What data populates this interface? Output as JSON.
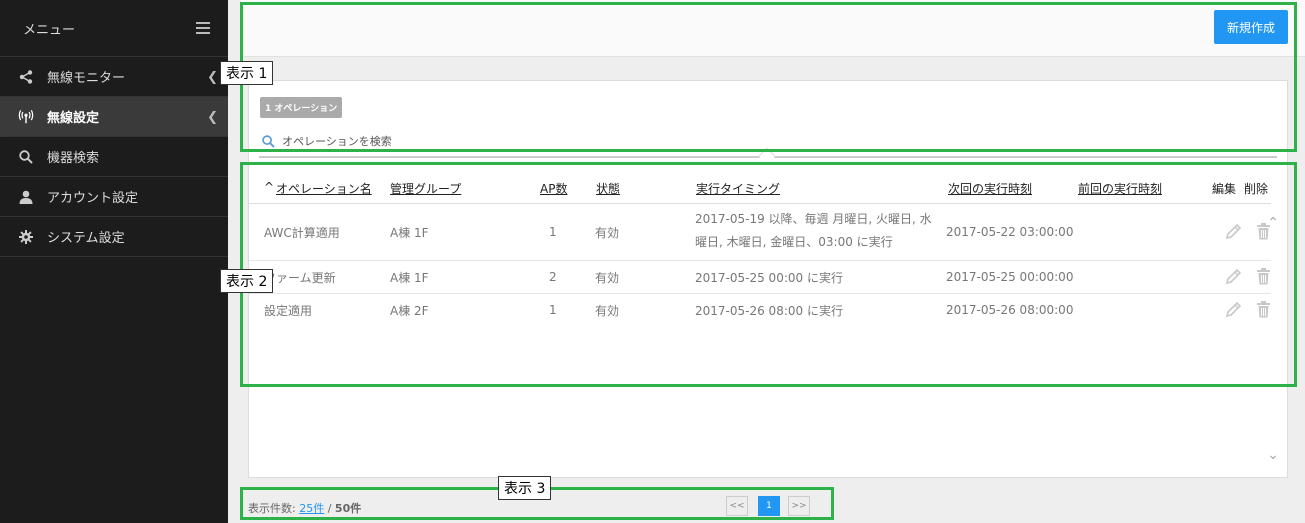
{
  "sidebar": {
    "title": "メニュー",
    "items": [
      {
        "label": "無線モニター",
        "icon": "share-icon"
      },
      {
        "label": "無線設定",
        "icon": "wireless-icon"
      },
      {
        "label": "機器検索",
        "icon": "search-icon"
      },
      {
        "label": "アカウント設定",
        "icon": "user-icon"
      },
      {
        "label": "システム設定",
        "icon": "gear-icon"
      }
    ]
  },
  "toolbar": {
    "new_label": "新規作成"
  },
  "badge": "1 オペレーション",
  "search": {
    "placeholder": "オペレーションを検索"
  },
  "table": {
    "columns": [
      "オペレーション名",
      "管理グループ",
      "AP数",
      "状態",
      "実行タイミング",
      "次回の実行時刻",
      "前回の実行時刻",
      "編集",
      "削除"
    ],
    "sort_indicator": "^",
    "rows": [
      {
        "name": "AWC計算適用",
        "group": "A棟 1F",
        "ap": "1",
        "status": "有効",
        "timing": "2017-05-19 以降、毎週 月曜日, 火曜日, 水曜日, 木曜日, 金曜日、03:00 に実行",
        "next": "2017-05-22 03:00:00",
        "prev": ""
      },
      {
        "name": "ファーム更新",
        "group": "A棟 1F",
        "ap": "2",
        "status": "有効",
        "timing": "2017-05-25 00:00 に実行",
        "next": "2017-05-25 00:00:00",
        "prev": ""
      },
      {
        "name": "設定適用",
        "group": "A棟 2F",
        "ap": "1",
        "status": "有効",
        "timing": "2017-05-26 08:00 に実行",
        "next": "2017-05-26 08:00:00",
        "prev": ""
      }
    ]
  },
  "footer": {
    "count_label": "表示件数:",
    "per_page": "25件",
    "separator": " / ",
    "total": "50件",
    "prev": "<<",
    "page": "1",
    "next": ">>"
  },
  "annotations": [
    "表示 1",
    "表示 2",
    "表示 3"
  ]
}
